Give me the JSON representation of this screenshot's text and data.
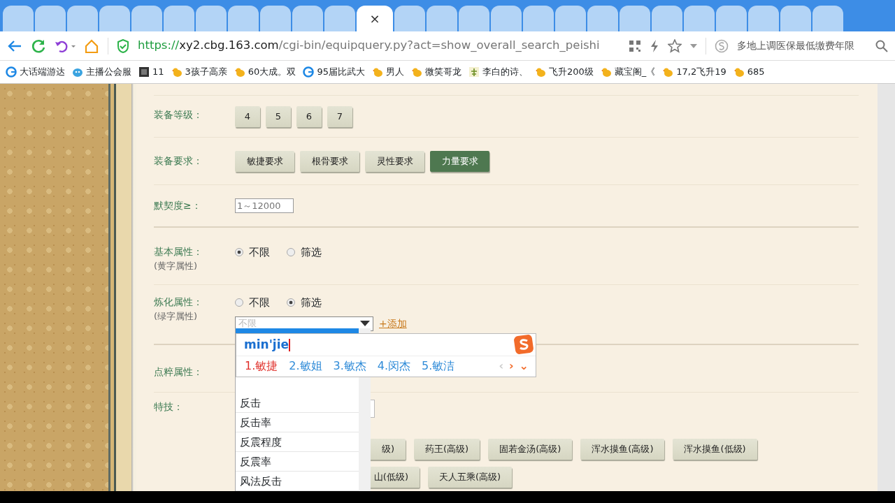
{
  "tabs": [
    {
      "selected": false
    },
    {
      "selected": false
    },
    {
      "selected": false
    },
    {
      "selected": false
    },
    {
      "selected": false
    },
    {
      "selected": false
    },
    {
      "selected": false
    },
    {
      "selected": false
    },
    {
      "selected": false
    },
    {
      "selected": false
    },
    {
      "selected": false
    },
    {
      "selected": true
    },
    {
      "selected": false
    },
    {
      "selected": false
    },
    {
      "selected": false
    },
    {
      "selected": false
    },
    {
      "selected": false
    },
    {
      "selected": false
    },
    {
      "selected": false
    },
    {
      "selected": false
    },
    {
      "selected": false
    },
    {
      "selected": false
    },
    {
      "selected": false
    },
    {
      "selected": false
    },
    {
      "selected": false
    },
    {
      "selected": false
    }
  ],
  "tab_close": "×",
  "toolbar": {
    "url_scheme": "https://",
    "url_host": "xy2.cbg.163.com",
    "url_path": "/cgi-bin/equipquery.py?act=show_overall_search_peishi",
    "search_text": "多地上调医保最低缴费年限"
  },
  "bookmarks": [
    {
      "kind": "globe",
      "label": "大话端游达"
    },
    {
      "kind": "face",
      "label": "主播公会服"
    },
    {
      "kind": "dark",
      "label": "11"
    },
    {
      "kind": "chick",
      "label": "3孩子高亲"
    },
    {
      "kind": "chick",
      "label": "60大成。双"
    },
    {
      "kind": "globe",
      "label": "95届比武大"
    },
    {
      "kind": "chick",
      "label": "男人"
    },
    {
      "kind": "chick",
      "label": "微笑哥龙"
    },
    {
      "kind": "plant",
      "label": "李白的诗、"
    },
    {
      "kind": "chick",
      "label": "飞升200级"
    },
    {
      "kind": "chick",
      "label": "藏宝阁_《"
    },
    {
      "kind": "chick",
      "label": "17,2飞升19"
    },
    {
      "kind": "chick",
      "label": "685"
    }
  ],
  "form": {
    "level": {
      "label": "装备等级：",
      "options": [
        {
          "label": "4",
          "selected": false
        },
        {
          "label": "5",
          "selected": false
        },
        {
          "label": "6",
          "selected": false
        },
        {
          "label": "7",
          "selected": false
        }
      ]
    },
    "requirement": {
      "label": "装备要求：",
      "options": [
        {
          "label": "敏捷要求",
          "selected": false
        },
        {
          "label": "根骨要求",
          "selected": false
        },
        {
          "label": "灵性要求",
          "selected": false
        },
        {
          "label": "力量要求",
          "selected": true
        }
      ]
    },
    "tacit": {
      "label": "默契度≥：",
      "placeholder": "1～12000"
    },
    "basic": {
      "label": "基本属性：",
      "note": "(黄字属性)",
      "options": [
        {
          "label": "不限",
          "selected": true
        },
        {
          "label": "筛选",
          "selected": false
        }
      ]
    },
    "refine": {
      "label": "炼化属性：",
      "note": "(绿字属性)",
      "options": [
        {
          "label": "不限",
          "selected": false
        },
        {
          "label": "筛选",
          "selected": true
        }
      ],
      "select_placeholder": "不限",
      "add_link": "+添加"
    },
    "dot": {
      "label": "点粹属性："
    },
    "skill": {
      "label": "特技：",
      "buttons": [
        [
          "级)",
          "药王(高级)",
          "固若金汤(高级)",
          "浑水摸鱼(高级)",
          "浑水摸鱼(低级)"
        ],
        [
          "山(低级)",
          "天人五乘(高级)"
        ]
      ]
    }
  },
  "dropdown_items": [
    "反击",
    "反击率",
    "反震程度",
    "反震率",
    "风法反击"
  ],
  "ime": {
    "composition": "min'jie",
    "candidates": [
      {
        "label": "1.敏捷",
        "selected": true
      },
      {
        "label": "2.敏姐",
        "selected": false
      },
      {
        "label": "3.敏杰",
        "selected": false
      },
      {
        "label": "4.闵杰",
        "selected": false
      },
      {
        "label": "5.敏洁",
        "selected": false
      }
    ],
    "prev": "‹",
    "next": "›",
    "more": "⌄"
  }
}
